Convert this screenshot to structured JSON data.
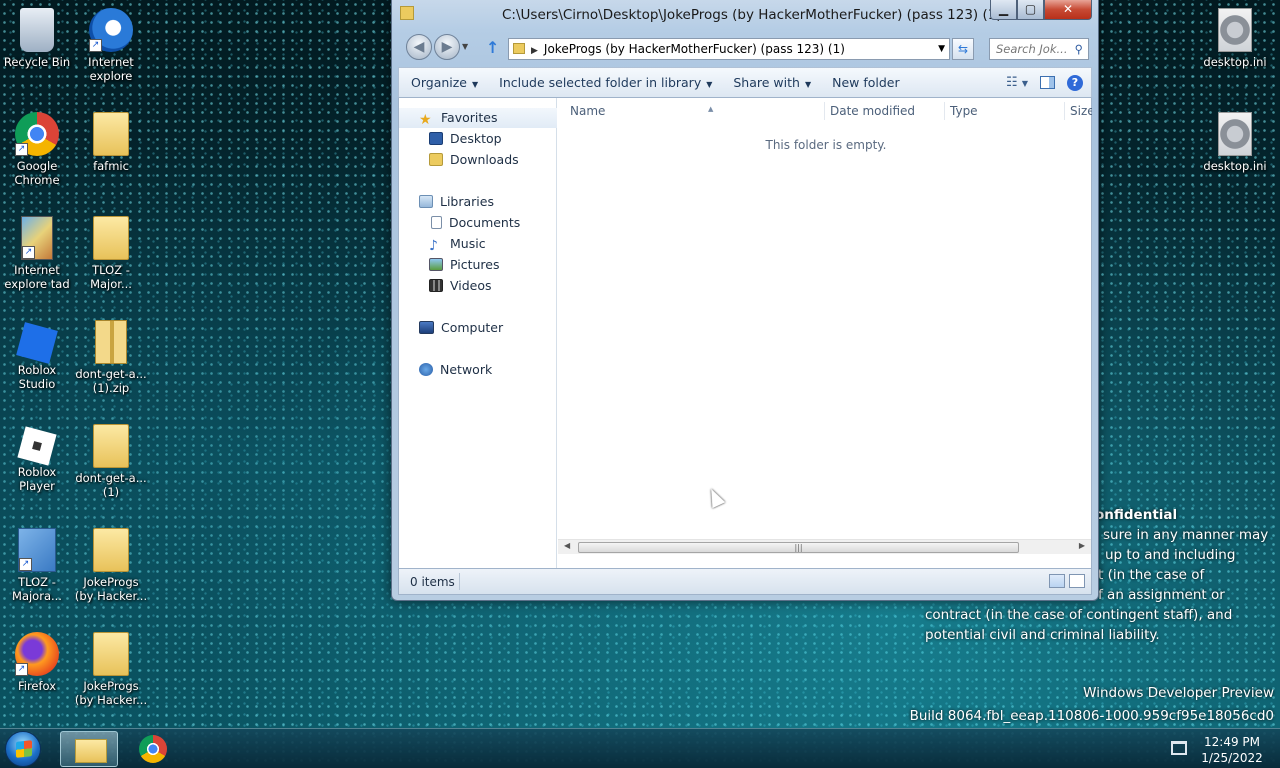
{
  "desktop": {
    "icons_left": [
      {
        "label": "Recycle Bin",
        "icon": "recycle-bin-icon"
      },
      {
        "label": "Internet explore",
        "icon": "internet-explorer-icon"
      },
      {
        "label": "Google Chrome",
        "icon": "chrome-icon"
      },
      {
        "label": "fafmic",
        "icon": "folder-icon"
      },
      {
        "label": "Internet explore tad",
        "icon": "game-icon"
      },
      {
        "label": "TLOZ - Major...",
        "icon": "folder-icon"
      },
      {
        "label": "Roblox Studio",
        "icon": "roblox-studio-icon"
      },
      {
        "label": "dont-get-a... (1).zip",
        "icon": "zip-folder-icon"
      },
      {
        "label": "Roblox Player",
        "icon": "roblox-player-icon"
      },
      {
        "label": "dont-get-a... (1)",
        "icon": "folder-icon"
      },
      {
        "label": "TLOZ - Majora...",
        "icon": "setup-icon"
      },
      {
        "label": "JokeProgs (by Hacker...",
        "icon": "folder-icon"
      },
      {
        "label": "Firefox",
        "icon": "firefox-icon"
      },
      {
        "label": "JokeProgs (by Hacker...",
        "icon": "folder-icon"
      }
    ],
    "icons_right": [
      {
        "label": "desktop.ini",
        "icon": "settings-file-icon"
      },
      {
        "label": "desktop.ini",
        "icon": "settings-file-icon"
      }
    ]
  },
  "window": {
    "title": "C:\\Users\\Cirno\\Desktop\\JokeProgs (by HackerMotherFucker) (pass 123) (1)",
    "buttons": {
      "minimize": "▁",
      "maximize": "▢",
      "close": "✕"
    },
    "address": "JokeProgs (by HackerMotherFucker) (pass 123) (1)",
    "search_placeholder": "Search Jok...",
    "toolbar": {
      "organize": "Organize",
      "include": "Include selected folder in library",
      "share": "Share with",
      "new_folder": "New folder"
    },
    "nav": {
      "favorites": "Favorites",
      "desktop": "Desktop",
      "downloads": "Downloads",
      "libraries": "Libraries",
      "documents": "Documents",
      "music": "Music",
      "pictures": "Pictures",
      "videos": "Videos",
      "computer": "Computer",
      "network": "Network"
    },
    "columns": {
      "name": "Name",
      "date": "Date modified",
      "type": "Type",
      "size": "Size"
    },
    "empty_message": "This folder is empty.",
    "status": "0 items"
  },
  "overlay": {
    "title": "onfidential",
    "lines": [
      "sure in any manner may",
      "up to and including",
      "t (in the case of",
      "f an assignment or",
      "contract (in the case of contingent staff), and",
      "potential civil and criminal liability."
    ],
    "watermark_line1": "Windows Developer Preview",
    "watermark_line2": "Build 8064.fbl_eeap.110806-1000.959cf95e18056cd0"
  },
  "taskbar": {
    "time": "12:49 PM",
    "date": "1/25/2022"
  }
}
